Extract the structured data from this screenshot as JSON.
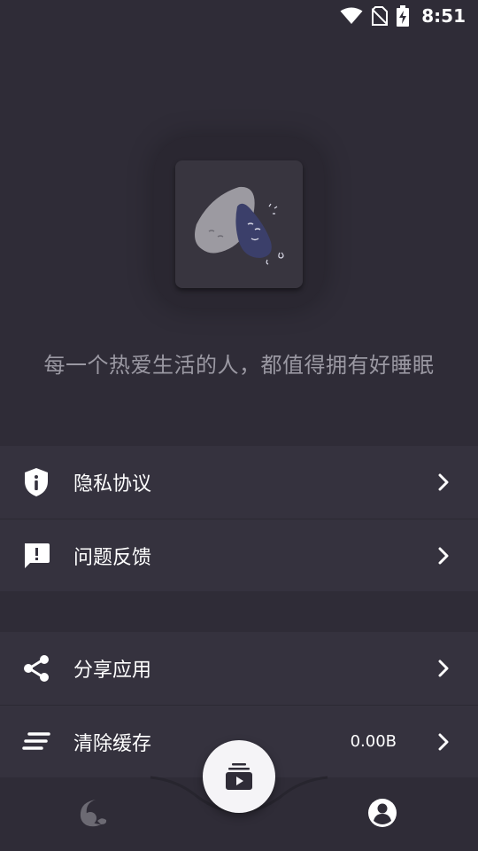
{
  "status_bar": {
    "time": "8:51",
    "icons": [
      "wifi-icon",
      "no-sim-icon",
      "battery-charging-icon"
    ]
  },
  "app": {
    "slogan": "每一个热爱生活的人，都值得拥有好睡眠"
  },
  "menu": {
    "group1": [
      {
        "icon": "shield-info-icon",
        "label": "隐私协议"
      },
      {
        "icon": "feedback-icon",
        "label": "问题反馈"
      }
    ],
    "group2": [
      {
        "icon": "share-icon",
        "label": "分享应用"
      },
      {
        "icon": "clear-cache-icon",
        "label": "清除缓存",
        "value": "0.00B"
      }
    ]
  },
  "bottom_nav": {
    "tabs": [
      {
        "icon": "sleep-moon-icon",
        "active": false
      },
      {
        "icon": "play-list-icon",
        "center": true
      },
      {
        "icon": "profile-icon",
        "active": true
      }
    ]
  },
  "colors": {
    "background": "#2f2c37",
    "card": "#35323e",
    "slogan_text": "#9a98a2",
    "fab": "#f5f4f7"
  }
}
